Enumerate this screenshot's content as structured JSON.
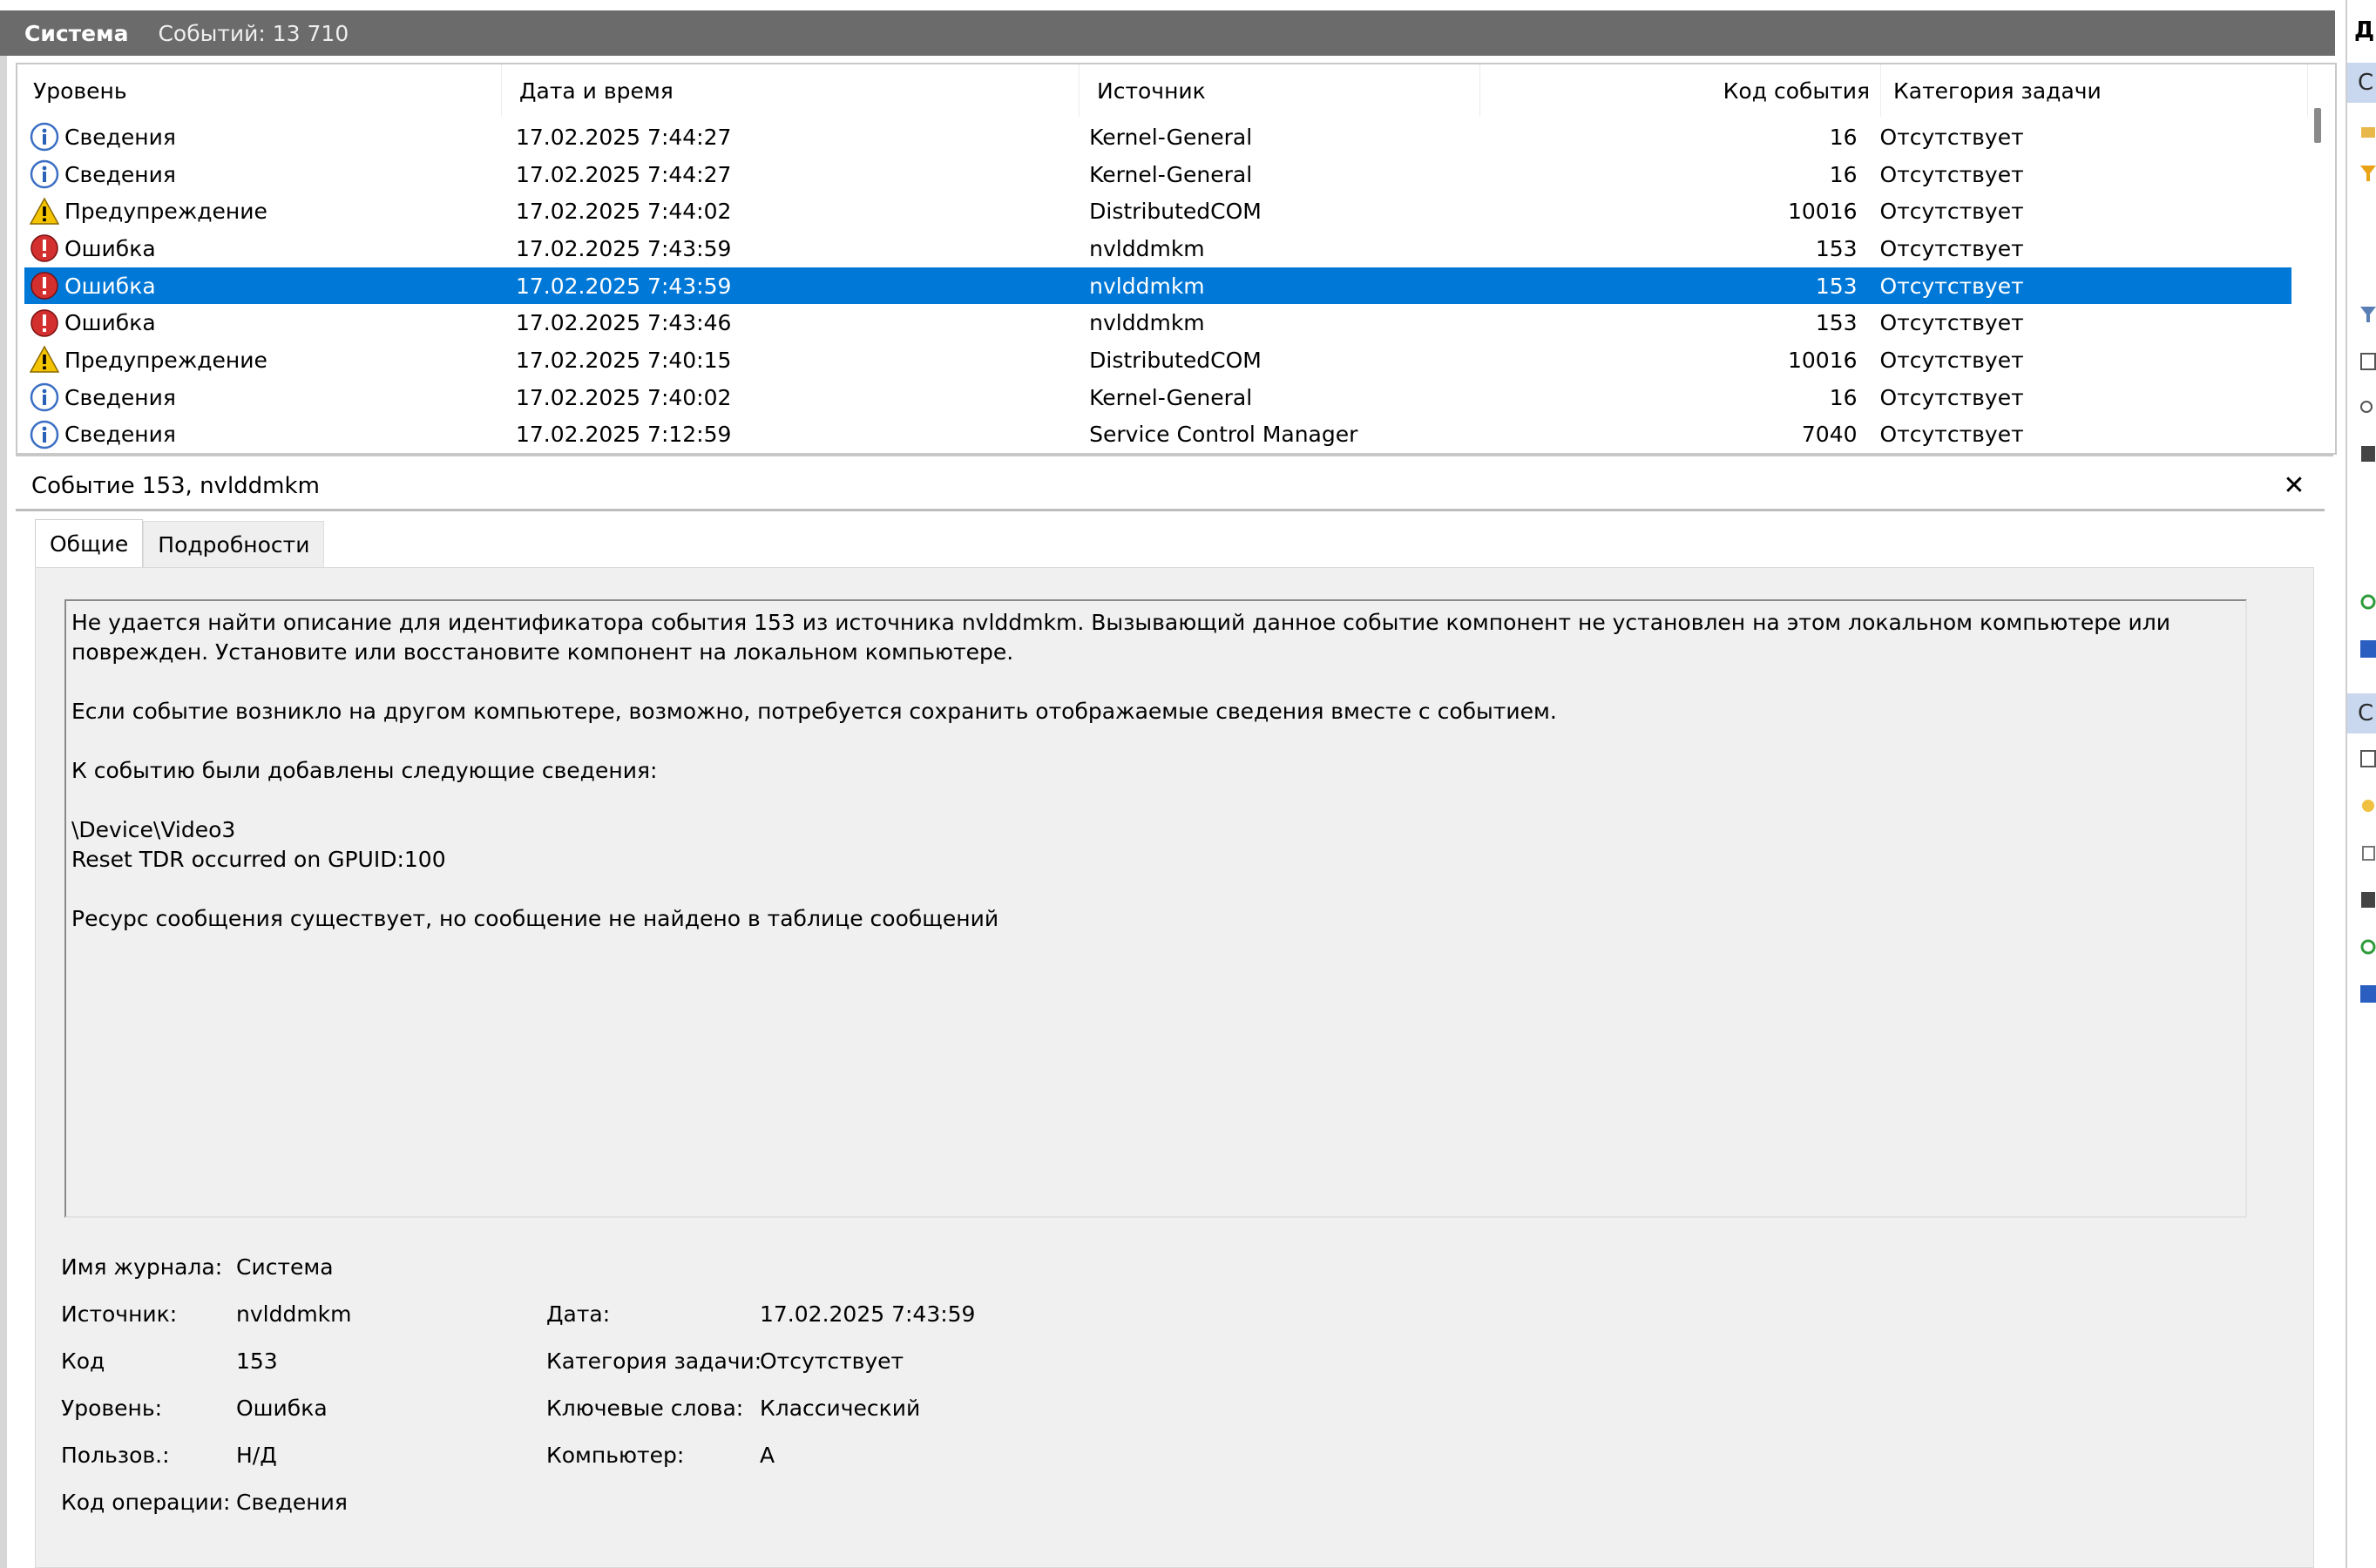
{
  "titlebar": {
    "log_name": "Система",
    "event_count": "Событий: 13 710"
  },
  "columns": {
    "level": "Уровень",
    "datetime": "Дата и время",
    "source": "Источник",
    "event_id": "Код события",
    "task_category": "Категория задачи"
  },
  "events": [
    {
      "level": "Сведения",
      "icon": "info-icon",
      "datetime": "17.02.2025 7:44:27",
      "source": "Kernel-General",
      "event_id": "16",
      "task_category": "Отсутствует",
      "selected": false
    },
    {
      "level": "Сведения",
      "icon": "info-icon",
      "datetime": "17.02.2025 7:44:27",
      "source": "Kernel-General",
      "event_id": "16",
      "task_category": "Отсутствует",
      "selected": false
    },
    {
      "level": "Предупреждение",
      "icon": "warning-icon",
      "datetime": "17.02.2025 7:44:02",
      "source": "DistributedCOM",
      "event_id": "10016",
      "task_category": "Отсутствует",
      "selected": false
    },
    {
      "level": "Ошибка",
      "icon": "error-icon",
      "datetime": "17.02.2025 7:43:59",
      "source": "nvlddmkm",
      "event_id": "153",
      "task_category": "Отсутствует",
      "selected": false
    },
    {
      "level": "Ошибка",
      "icon": "error-icon",
      "datetime": "17.02.2025 7:43:59",
      "source": "nvlddmkm",
      "event_id": "153",
      "task_category": "Отсутствует",
      "selected": true
    },
    {
      "level": "Ошибка",
      "icon": "error-icon",
      "datetime": "17.02.2025 7:43:46",
      "source": "nvlddmkm",
      "event_id": "153",
      "task_category": "Отсутствует",
      "selected": false
    },
    {
      "level": "Предупреждение",
      "icon": "warning-icon",
      "datetime": "17.02.2025 7:40:15",
      "source": "DistributedCOM",
      "event_id": "10016",
      "task_category": "Отсутствует",
      "selected": false
    },
    {
      "level": "Сведения",
      "icon": "info-icon",
      "datetime": "17.02.2025 7:40:02",
      "source": "Kernel-General",
      "event_id": "16",
      "task_category": "Отсутствует",
      "selected": false
    },
    {
      "level": "Сведения",
      "icon": "info-icon",
      "datetime": "17.02.2025 7:12:59",
      "source": "Service Control Manager",
      "event_id": "7040",
      "task_category": "Отсутствует",
      "selected": false
    }
  ],
  "detail": {
    "title": "Событие 153, nvlddmkm",
    "tabs": [
      "Общие",
      "Подробности"
    ],
    "description": [
      "Не удается найти описание для идентификатора события 153 из источника nvlddmkm. Вызывающий данное событие компонент не установлен на этом локальном компьютере или поврежден. Установите или восстановите компонент на локальном компьютере.",
      "",
      "Если событие возникло на другом компьютере, возможно, потребуется сохранить отображаемые сведения вместе с событием.",
      "",
      "К событию были добавлены следующие сведения:",
      "",
      "\\Device\\Video3",
      "Reset TDR occurred on GPUID:100",
      "",
      "Ресурс сообщения существует, но сообщение не найдено в таблице сообщений"
    ],
    "props": {
      "log_name_label": "Имя журнала:",
      "log_name": "Система",
      "source_label": "Источник:",
      "source": "nvlddmkm",
      "logged_label": "Дата:",
      "logged": "17.02.2025 7:43:59",
      "event_id_label": "Код",
      "event_id": "153",
      "task_category_label": "Категория задачи:",
      "task_category": "Отсутствует",
      "level_label": "Уровень:",
      "level": "Ошибка",
      "keywords_label": "Ключевые слова:",
      "keywords": "Классический",
      "user_label": "Пользов.:",
      "user": "Н/Д",
      "computer_label": "Компьютер:",
      "computer": "А",
      "opcode_label": "Код операции:",
      "opcode": "Сведения"
    }
  },
  "right_panel": {
    "header": "Д",
    "band1": "С",
    "band2": "С"
  },
  "colors": {
    "selection": "#0078d7",
    "titlebar": "#6b6b6b",
    "error": "#d32f2f",
    "warning": "#f5c400",
    "info": "#2a62b8"
  }
}
